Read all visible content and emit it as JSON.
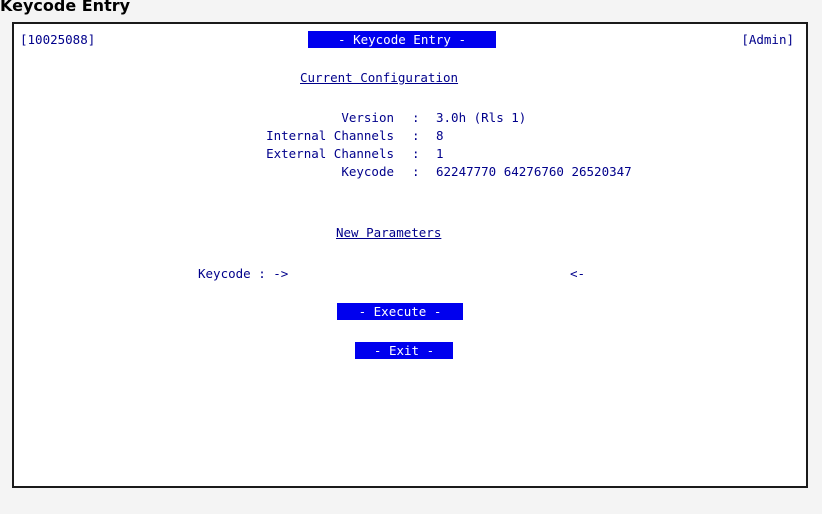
{
  "page_caption": "Keycode Entry",
  "header": {
    "serial": "[10025088]",
    "title": "- Keycode Entry -",
    "user": "[Admin]"
  },
  "current_config": {
    "heading": "Current Configuration",
    "rows": [
      {
        "label": "Version",
        "sep": ":",
        "value": "3.0h (Rls 1)"
      },
      {
        "label": "Internal Channels",
        "sep": ":",
        "value": "8"
      },
      {
        "label": "External Channels",
        "sep": ":",
        "value": "1"
      },
      {
        "label": "Keycode",
        "sep": ":",
        "value": "62247770 64276760 26520347"
      }
    ]
  },
  "new_params": {
    "heading": "New Parameters",
    "keycode_label": "Keycode : ->",
    "keycode_value": "",
    "keycode_end": "<-"
  },
  "buttons": {
    "execute": "- Execute -",
    "exit": "- Exit -"
  },
  "colors": {
    "text": "#00008b",
    "highlight_bg": "#0000ee",
    "highlight_fg": "#ffffff"
  }
}
